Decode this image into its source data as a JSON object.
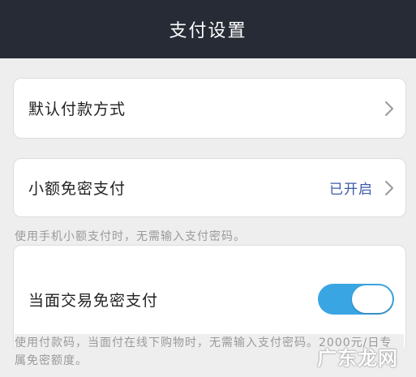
{
  "header": {
    "title": "支付设置"
  },
  "default_payment": {
    "label": "默认付款方式"
  },
  "small_amount": {
    "label": "小额免密支付",
    "status": "已开启",
    "note": "使用手机小额支付时，无需输入支付密码。"
  },
  "face_to_face": {
    "label": "当面交易免密支付",
    "toggle_on": true,
    "note": "使用付款码，当面付在线下购物时，无需输入支付密码。2000元/日专属免密额度。"
  },
  "watermark": "广东龙网",
  "colors": {
    "header_bg": "#272b36",
    "toggle_on": "#3aa5e3",
    "status_text": "#3b5aa8"
  }
}
